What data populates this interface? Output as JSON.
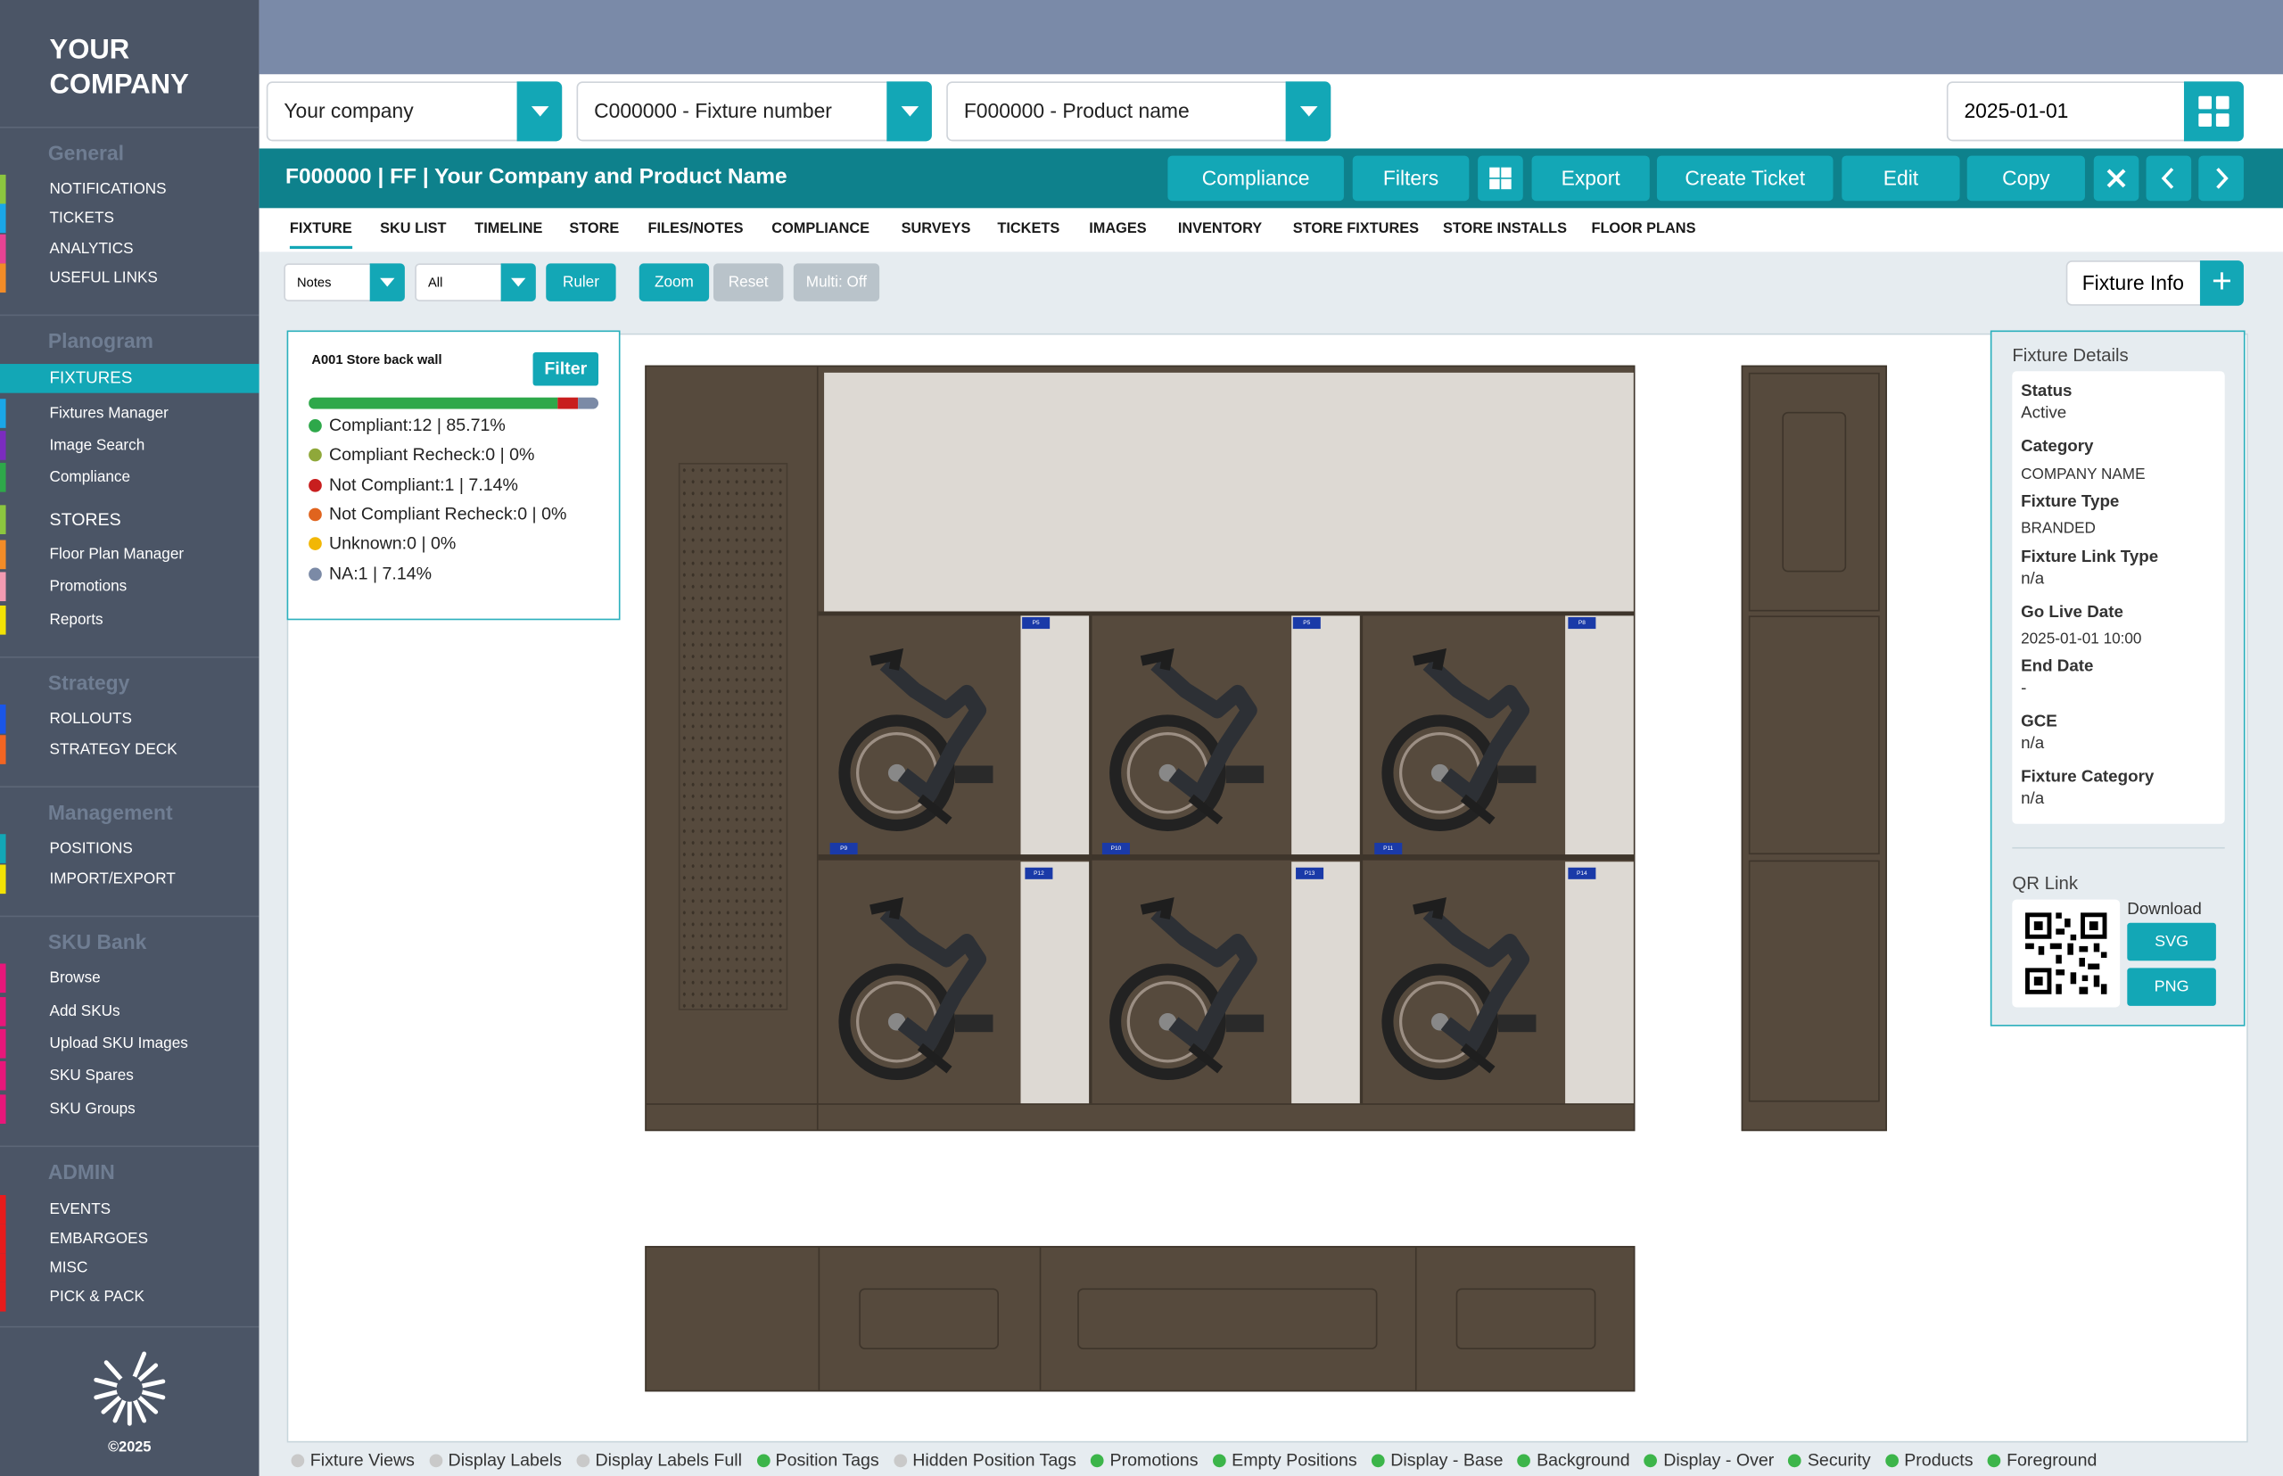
{
  "brand": {
    "logo_line1": "YOUR",
    "logo_line2": "COMPANY",
    "footer": "©2025"
  },
  "sidebar": {
    "sections": [
      {
        "title": "General",
        "items": [
          "NOTIFICATIONS",
          "TICKETS",
          "ANALYTICS",
          "USEFUL LINKS"
        ]
      },
      {
        "title": "Planogram",
        "items": [
          "FIXTURES",
          "Fixtures Manager",
          "Image Search",
          "Compliance",
          "STORES",
          "Floor Plan Manager",
          "Promotions",
          "Reports"
        ]
      },
      {
        "title": "Strategy",
        "items": [
          "ROLLOUTS",
          "STRATEGY DECK"
        ]
      },
      {
        "title": "Management",
        "items": [
          "POSITIONS",
          "IMPORT/EXPORT"
        ]
      },
      {
        "title": "SKU Bank",
        "items": [
          "Browse",
          "Add SKUs",
          "Upload SKU Images",
          "SKU Spares",
          "SKU Groups"
        ]
      },
      {
        "title": "ADMIN",
        "items": [
          "EVENTS",
          "EMBARGOES",
          "MISC",
          "PICK & PACK"
        ]
      }
    ],
    "active_item": "FIXTURES"
  },
  "filters": {
    "company": "Your company",
    "fixture": "C000000 - Fixture number",
    "product": "F000000 - Product name",
    "date": "2025-01-01"
  },
  "header": {
    "title": "F000000 | FF | Your Company and Product Name",
    "buttons": {
      "compliance": "Compliance",
      "filters": "Filters",
      "export": "Export",
      "create_ticket": "Create Ticket",
      "edit": "Edit",
      "copy": "Copy"
    }
  },
  "tabs": [
    "FIXTURE",
    "SKU LIST",
    "TIMELINE",
    "STORE",
    "FILES/NOTES",
    "COMPLIANCE",
    "SURVEYS",
    "TICKETS",
    "IMAGES",
    "INVENTORY",
    "STORE FIXTURES",
    "STORE INSTALLS",
    "FLOOR PLANS"
  ],
  "toolbar": {
    "notes": "Notes",
    "all": "All",
    "ruler": "Ruler",
    "zoom": "Zoom",
    "reset": "Reset",
    "multi": "Multi: Off",
    "fixture_info": "Fixture Info"
  },
  "compliance_panel": {
    "title": "A001 Store back wall",
    "filter": "Filter",
    "progress": [
      {
        "status": "Compliant",
        "fraction": 0.8571,
        "color": "#2ea84a"
      },
      {
        "status": "Not Compliant",
        "fraction": 0.0714,
        "color": "#c81e1e"
      },
      {
        "status": "NA",
        "fraction": 0.0714,
        "color": "#7b8aa6"
      }
    ],
    "rows": [
      {
        "text": "Compliant:12  |  85.71%",
        "color": "#2ea84a"
      },
      {
        "text": "Compliant Recheck:0  |  0%",
        "color": "#8fa83a"
      },
      {
        "text": "Not Compliant:1  |  7.14%",
        "color": "#c81e1e"
      },
      {
        "text": "Not Compliant Recheck:0  |  0%",
        "color": "#e0641e"
      },
      {
        "text": "Unknown:0  |  0%",
        "color": "#f2b705"
      },
      {
        "text": "NA:1  |  7.14%",
        "color": "#7b8aa6"
      }
    ]
  },
  "position_tags": [
    "P5",
    "P5",
    "P8",
    "P9",
    "P10",
    "P11",
    "P12",
    "P13",
    "P14"
  ],
  "details": {
    "heading": "Fixture Details",
    "fields": [
      {
        "label": "Status",
        "value": "Active"
      },
      {
        "label": "Category",
        "value": "COMPANY NAME"
      },
      {
        "label": "Fixture Type",
        "value": "BRANDED"
      },
      {
        "label": "Fixture Link Type",
        "value": "n/a"
      },
      {
        "label": "Go Live Date",
        "value": "2025-01-01 10:00"
      },
      {
        "label": "End Date",
        "value": "-"
      },
      {
        "label": "GCE",
        "value": "n/a"
      },
      {
        "label": "Fixture Category",
        "value": "n/a"
      }
    ],
    "qr_heading": "QR Link",
    "download": "Download",
    "svg": "SVG",
    "png": "PNG"
  },
  "legend": [
    {
      "label": "Fixture Views",
      "color": "#c9c9c9"
    },
    {
      "label": "Display Labels",
      "color": "#c9c9c9"
    },
    {
      "label": "Display Labels Full",
      "color": "#c9c9c9"
    },
    {
      "label": "Position Tags",
      "color": "#3cb54a"
    },
    {
      "label": "Hidden Position Tags",
      "color": "#c9c9c9"
    },
    {
      "label": "Promotions",
      "color": "#3cb54a"
    },
    {
      "label": "Empty Positions",
      "color": "#3cb54a"
    },
    {
      "label": "Display - Base",
      "color": "#3cb54a"
    },
    {
      "label": "Background",
      "color": "#3cb54a"
    },
    {
      "label": "Display - Over",
      "color": "#3cb54a"
    },
    {
      "label": "Security",
      "color": "#3cb54a"
    },
    {
      "label": "Products",
      "color": "#3cb54a"
    },
    {
      "label": "Foreground",
      "color": "#3cb54a"
    }
  ],
  "colors": {
    "accent": "#13a7b6",
    "header": "#0e818c",
    "sidebar": "#4b5566",
    "topband": "#7a8aa8",
    "fixture": "#564a3d"
  }
}
